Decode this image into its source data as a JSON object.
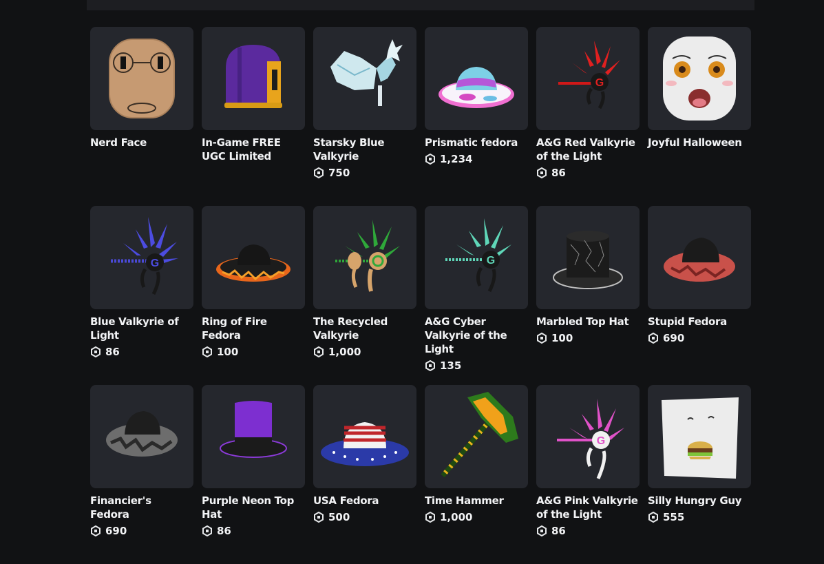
{
  "items": [
    {
      "name": "Nerd Face",
      "price": ""
    },
    {
      "name": "In-Game FREE UGC Limited",
      "price": ""
    },
    {
      "name": "Starsky Blue Valkyrie",
      "price": "750"
    },
    {
      "name": "Prismatic fedora",
      "price": "1,234"
    },
    {
      "name": "A&G Red Valkyrie of the Light",
      "price": "86"
    },
    {
      "name": "Joyful Halloween",
      "price": ""
    },
    {
      "name": "Blue Valkyrie of Light",
      "price": "86"
    },
    {
      "name": "Ring of Fire Fedora",
      "price": "100"
    },
    {
      "name": "The Recycled Valkyrie",
      "price": "1,000"
    },
    {
      "name": "A&G Cyber Valkyrie of the Light",
      "price": "135"
    },
    {
      "name": "Marbled Top Hat",
      "price": "100"
    },
    {
      "name": "Stupid Fedora",
      "price": "690"
    },
    {
      "name": "Financier's Fedora",
      "price": "690"
    },
    {
      "name": "Purple Neon Top Hat",
      "price": "86"
    },
    {
      "name": "USA Fedora",
      "price": "500"
    },
    {
      "name": "Time Hammer",
      "price": "1,000"
    },
    {
      "name": "A&G Pink Valkyrie of the Light",
      "price": "86"
    },
    {
      "name": "Silly Hungry Guy",
      "price": "555"
    }
  ],
  "icons": {
    "currency": "robux-icon"
  }
}
